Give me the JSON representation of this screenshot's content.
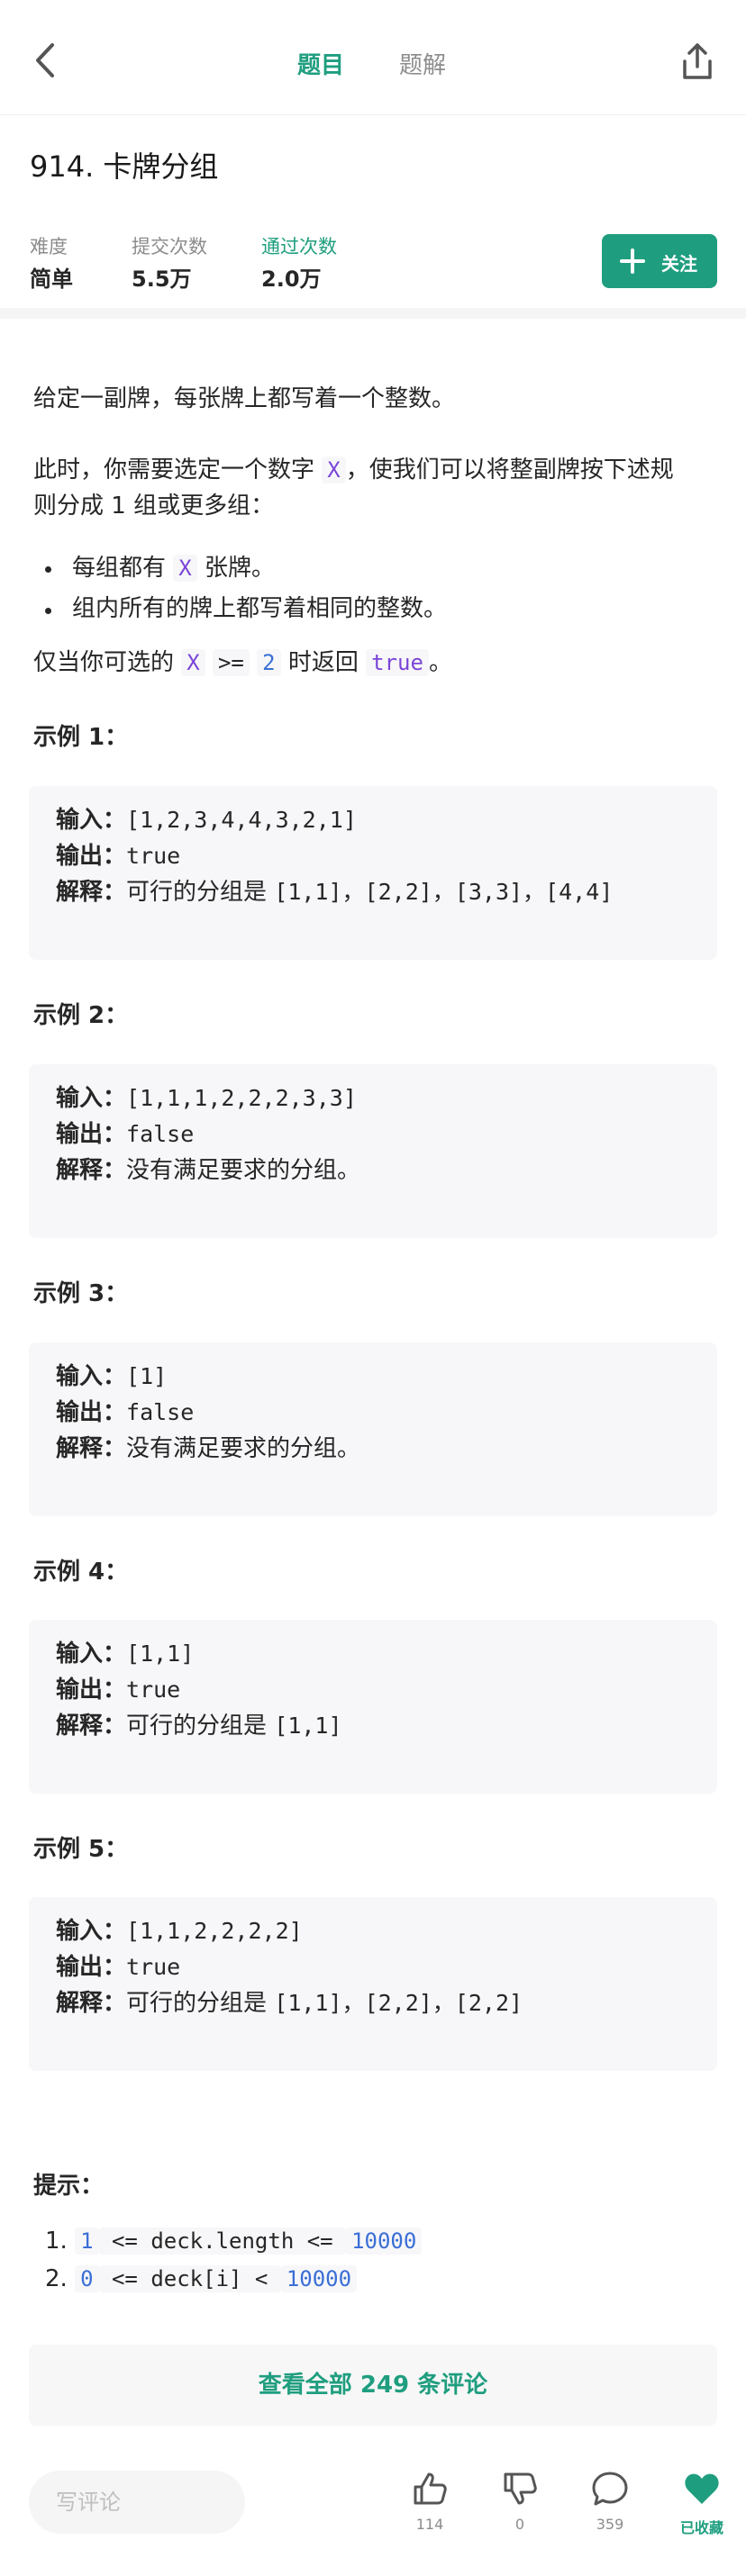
{
  "header": {
    "tabs": [
      {
        "label": "题目",
        "active": true
      },
      {
        "label": "题解",
        "active": false
      }
    ]
  },
  "problem": {
    "title": "914. 卡牌分组",
    "stats": [
      {
        "label": "难度",
        "value": "简单"
      },
      {
        "label": "提交次数",
        "value": "5.5万"
      },
      {
        "label": "通过次数",
        "value": "2.0万"
      }
    ],
    "follow_label": "关注",
    "desc1": "给定一副牌，每张牌上都写着一个整数。",
    "desc2_a": "此时，你需要选定一个数字 ",
    "desc2_code": "X",
    "desc2_b": "，使我们可以将整副牌按下述规",
    "desc2_c": "则分成 1 组或更多组：",
    "bullet1_a": "每组都有 ",
    "bullet1_code": "X",
    "bullet1_b": " 张牌。",
    "bullet2": "组内所有的牌上都写着相同的整数。",
    "desc3_a": "仅当你可选的 ",
    "desc3_code1": "X",
    "desc3_code2": ">=",
    "desc3_code3": "2",
    "desc3_b": " 时返回 ",
    "desc3_code4": "true",
    "desc3_c": "。"
  },
  "labels": {
    "input": "输入：",
    "output": "输出：",
    "explain": "解释："
  },
  "examples": [
    {
      "title": "示例 1：",
      "input": "[1,2,3,4,4,3,2,1]",
      "output": "true",
      "explain_prefix": "可行的分组是 ",
      "explain_code": "[1,1]，[2,2]，[3,3]，[4,4]"
    },
    {
      "title": "示例 2：",
      "input": "[1,1,1,2,2,2,3,3]",
      "output": "false",
      "explain_prefix": "没有满足要求的分组。",
      "explain_code": ""
    },
    {
      "title": "示例 3：",
      "input": "[1]",
      "output": "false",
      "explain_prefix": "没有满足要求的分组。",
      "explain_code": ""
    },
    {
      "title": "示例 4：",
      "input": "[1,1]",
      "output": "true",
      "explain_prefix": "可行的分组是 ",
      "explain_code": "[1,1]"
    },
    {
      "title": "示例 5：",
      "input": "[1,1,2,2,2,2]",
      "output": "true",
      "explain_prefix": "可行的分组是 ",
      "explain_code": "[1,1]，[2,2]，[2,2]"
    }
  ],
  "hints": {
    "title": "提示：",
    "items": [
      {
        "num": "1.",
        "a": "1",
        "b": " <= deck.length <= ",
        "c": "10000"
      },
      {
        "num": "2.",
        "a": "0",
        "b": " <= deck[i] < ",
        "c": "10000"
      }
    ]
  },
  "comments_button": "查看全部 249 条评论",
  "bottom_bar": {
    "write_placeholder": "写评论",
    "like_count": "114",
    "dislike_count": "0",
    "comment_count": "359",
    "favorite_label": "已收藏"
  },
  "colors": {
    "accent": "#1f9e7f",
    "code_purple": "#7a45d8",
    "code_blue": "#3b6fd6"
  }
}
